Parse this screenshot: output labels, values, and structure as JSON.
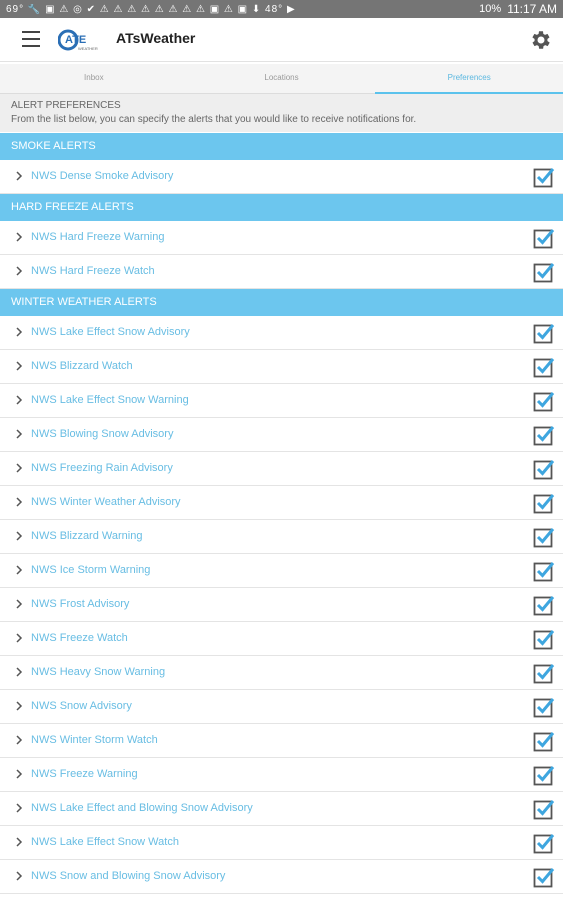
{
  "status_bar": {
    "left": "69° 🔧 ▣ ⚠ ◎ ✔ ⚠ ⚠ ⚠ ⚠ ⚠ ⚠ ⚠ ⚠ ▣ ⚠ ▣ ⬇ 48° ▶",
    "battery": "10%",
    "time": "11:17 AM"
  },
  "app_bar": {
    "title": "ATsWeather",
    "logo_text": "ATE",
    "logo_subtext": "WEATHER"
  },
  "tabs": [
    "Inbox",
    "Locations",
    "Preferences"
  ],
  "intro": {
    "heading": "ALERT PREFERENCES",
    "description": "From the list below, you can specify the alerts that you would like to receive notifications for."
  },
  "sections": [
    {
      "title": "SMOKE ALERTS",
      "items": [
        {
          "label": "NWS Dense Smoke Advisory",
          "checked": true
        }
      ]
    },
    {
      "title": "HARD FREEZE ALERTS",
      "items": [
        {
          "label": "NWS Hard Freeze Warning",
          "checked": true
        },
        {
          "label": "NWS Hard Freeze Watch",
          "checked": true
        }
      ]
    },
    {
      "title": "WINTER WEATHER ALERTS",
      "items": [
        {
          "label": "NWS Lake Effect Snow Advisory",
          "checked": true
        },
        {
          "label": "NWS Blizzard Watch",
          "checked": true
        },
        {
          "label": "NWS Lake Effect Snow Warning",
          "checked": true
        },
        {
          "label": "NWS Blowing Snow Advisory",
          "checked": true
        },
        {
          "label": "NWS Freezing Rain Advisory",
          "checked": true
        },
        {
          "label": "NWS Winter Weather Advisory",
          "checked": true
        },
        {
          "label": "NWS Blizzard Warning",
          "checked": true
        },
        {
          "label": "NWS Ice Storm Warning",
          "checked": true
        },
        {
          "label": "NWS Frost Advisory",
          "checked": true
        },
        {
          "label": "NWS Freeze Watch",
          "checked": true
        },
        {
          "label": "NWS Heavy Snow Warning",
          "checked": true
        },
        {
          "label": "NWS Snow Advisory",
          "checked": true
        },
        {
          "label": "NWS Winter Storm Watch",
          "checked": true
        },
        {
          "label": "NWS Freeze Warning",
          "checked": true
        },
        {
          "label": "NWS Lake Effect and Blowing Snow Advisory",
          "checked": true
        },
        {
          "label": "NWS Lake Effect Snow Watch",
          "checked": true
        },
        {
          "label": "NWS Snow and Blowing Snow Advisory",
          "checked": true
        }
      ]
    }
  ],
  "icons": {
    "menu": "hamburger-icon",
    "settings": "gear-icon",
    "row": "chevron-right-icon",
    "checkbox": "checkbox-checked-icon"
  },
  "colors": {
    "accent": "#6cc6ee",
    "link": "#68bde3",
    "checkbox": "#3ea6df"
  }
}
